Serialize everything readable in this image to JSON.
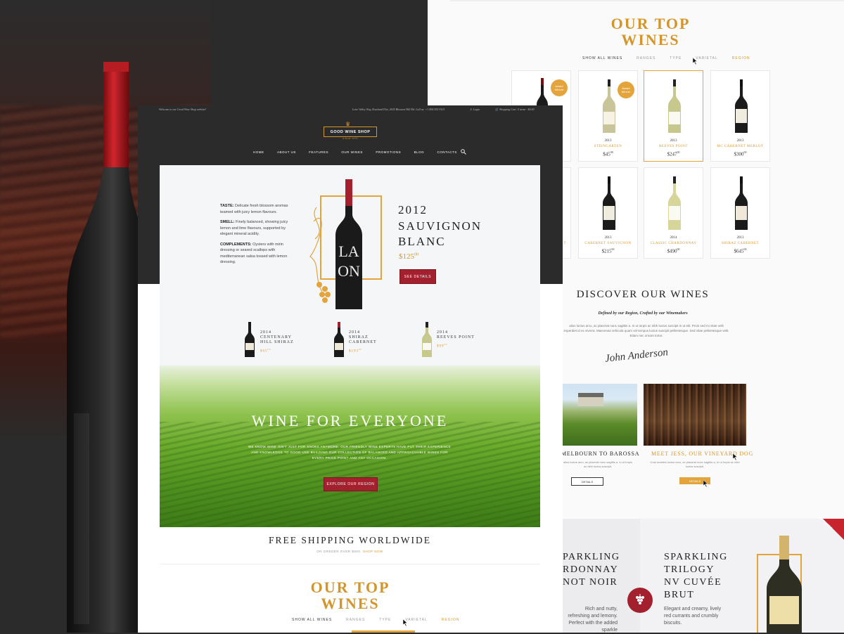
{
  "colors": {
    "accent": "#d4962a",
    "wine_red": "#a3202e",
    "dark": "#2b2b2b"
  },
  "topbar": {
    "welcome": "Welcome to our Good Wine Shop website!",
    "address": "Lone Valley Way, Rossland Flat, 2635 Blossom Hill Rd.  Call us: +1 800 555 9121",
    "login": "Login",
    "cart": "Shopping Cart: 0 items - $0.00"
  },
  "brand": {
    "name": "GOOD WINE SHOP",
    "since": "SINCE 1875"
  },
  "nav": [
    "HOME",
    "ABOUT US",
    "FEATURES",
    "OUR WINES",
    "PROMOTIONS",
    "BLOG",
    "CONTACTS"
  ],
  "hero": {
    "taste_label": "TASTE:",
    "taste_text": "Delicate fresh blossom aromas teamed with juicy lemon flavours.",
    "smell_label": "SMELL:",
    "smell_text": "Finely balanced, showing juicy lemon and lime flavours, supported by elegant mineral acidity.",
    "complements_label": "COMPLEMENTS:",
    "complements_text": "Oysters with mirin dressing or seared scallops with mediterranean salsa tossed with lemon dressing.",
    "year": "2012",
    "name1": "SAUVIGNON",
    "name2": "BLANC",
    "price": "$125",
    "price_cents": "00",
    "button": "SEE DETAILS"
  },
  "mini_wines": [
    {
      "year": "2014",
      "l1": "CENTENARY",
      "l2": "HILL SHIRAZ",
      "price": "$65",
      "cents": "00"
    },
    {
      "year": "2014",
      "l1": "SHIRAZ",
      "l2": "CABERNET",
      "price": "$193",
      "cents": "00"
    },
    {
      "year": "2014",
      "l1": "REEVES POINT",
      "l2": "",
      "price": "$99",
      "cents": "00"
    }
  ],
  "vineyard": {
    "title": "WINE FOR EVERYONE",
    "text": "WE KNOW WINE ISN'T JUST FOR SNOBS ANYMORE. OUR FRIENDLY WINE EXPERTS HAVE PUT THEIR EXPERIENCE AND KNOWLEDGE TO GOOD USE BUILDING OUR COLLECTION OF BALANCED AND APPROACHABLE WINES FOR EVERY PRICE POINT AND ANY OCCASION.",
    "button": "EXPLORE OUR REGION"
  },
  "shipping": {
    "title": "FREE SHIPPING WORLDWIDE",
    "sub": "ON OREDER OVER $500.",
    "link": "SHOP NOW"
  },
  "top_wines": {
    "title1": "OUR TOP",
    "title2": "WINES",
    "tabs": [
      "SHOW ALL WINES",
      "RANGES",
      "TYPE",
      "VARIETAL",
      "REGION"
    ]
  },
  "right_cards": [
    {
      "year": "",
      "name": "",
      "price": "",
      "cents": "",
      "badge": "Award Winner"
    },
    {
      "year": "2013",
      "name": "STEINGARTEN",
      "price": "$45",
      "cents": "00",
      "badge": "Award Winner"
    },
    {
      "year": "2013",
      "name": "REEVES POINT",
      "price": "$247",
      "cents": "00",
      "badge": ""
    },
    {
      "year": "2013",
      "name": "MC CABERNET MERLOT",
      "price": "$300",
      "cents": "00",
      "badge": ""
    },
    {
      "year": "",
      "name": "T",
      "price": "",
      "cents": "",
      "badge": ""
    },
    {
      "year": "2013",
      "name": "CABERNET SAUVIGNON",
      "price": "$215",
      "cents": "00",
      "badge": ""
    },
    {
      "year": "2014",
      "name": "CLASSIC CHARDONNAY",
      "price": "$490",
      "cents": "00",
      "badge": ""
    },
    {
      "year": "2013",
      "name": "SHIRAZ CABERNET",
      "price": "$645",
      "cents": "00",
      "badge": ""
    }
  ],
  "discover": {
    "title": "DISCOVER OUR WINES",
    "subtitle": "Defined by our Region, Crafted by our Winemakers",
    "text": "alius luctus arcu, ac placerat nunc sagittis a. In ut turpis ac nibh luctus suscipit in ut elit. Proin sed mi vitae velit imperdiet id ex viverra. Maecenas vehicula quam vel tempus luctus suscipit pellentesque. Sed vitae pellentesque velit. Etiam nec ornare tortor.",
    "signature": "John Anderson"
  },
  "blogs": [
    {
      "title": "MELBOURN TO BAROSSA",
      "text": "alius luctus arcu, ac placerat nunc sagittis a. In ut turpis ac nibh luctus suscipit.",
      "button": "DETAILS"
    },
    {
      "title": "MEET JESS, OUR VINEYARD DOG",
      "text": "Cras sodales luctus arcu, ac placerat nunc sagittis a. In ut turpis ac nibh luctus suscipit.",
      "button": "DETAILS"
    }
  ],
  "sparkling": {
    "left_l1": "PARKLING",
    "left_l2": "RDONNAY",
    "left_l3": "NOT NOIR",
    "left_text": "Rich and nutty, refreshing and lemony. Perfect with the added sparkle",
    "right_l1": "SPARKLING",
    "right_l2": "TRILOGY",
    "right_l3": "NV CUVÉE",
    "right_l4": "BRUT",
    "right_text": "Elegant and creamy, lively red currants and crumbly biscuits.",
    "corner": "Sale Sparkling",
    "bottle_label": "TRILOGY"
  }
}
